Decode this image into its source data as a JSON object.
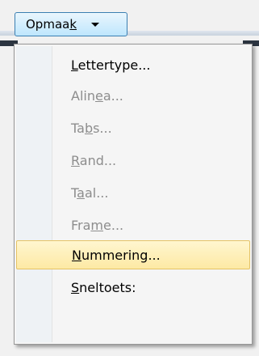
{
  "toolbar": {
    "button_label": "Opmaak"
  },
  "menu": {
    "items": [
      {
        "label": "Lettertype...",
        "accel_index": 0,
        "enabled": true
      },
      {
        "label": "Alinea...",
        "accel_index": 4,
        "enabled": false
      },
      {
        "label": "Tabs...",
        "accel_index": 2,
        "enabled": false
      },
      {
        "label": "Rand...",
        "accel_index": 0,
        "enabled": false
      },
      {
        "label": "Taal...",
        "accel_index": 1,
        "enabled": false
      },
      {
        "label": "Frame...",
        "accel_index": 3,
        "enabled": false
      },
      {
        "label": "Nummering...",
        "accel_index": 0,
        "enabled": true,
        "highlighted": true
      },
      {
        "label": "Sneltoets:",
        "accel_index": 0,
        "enabled": true
      }
    ]
  },
  "colors": {
    "highlight": "#fde9a4",
    "disabled_text": "#8d8d8d"
  }
}
